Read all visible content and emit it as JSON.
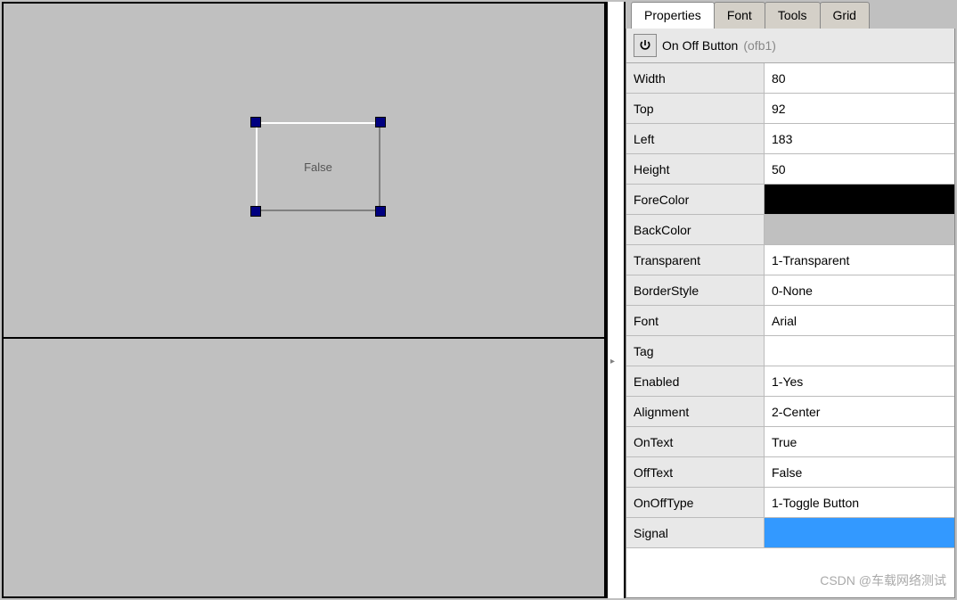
{
  "canvas": {
    "control_text": "False"
  },
  "tabs": [
    "Properties",
    "Font",
    "Tools",
    "Grid"
  ],
  "active_tab": 0,
  "header": {
    "type_label": "On Off Button",
    "control_name": "(ofb1)"
  },
  "properties": [
    {
      "label": "Width",
      "value": "80",
      "kind": "text"
    },
    {
      "label": "Top",
      "value": "92",
      "kind": "text"
    },
    {
      "label": "Left",
      "value": "183",
      "kind": "text"
    },
    {
      "label": "Height",
      "value": "50",
      "kind": "text"
    },
    {
      "label": "ForeColor",
      "value": "#000000",
      "kind": "color-black"
    },
    {
      "label": "BackColor",
      "value": "#c0c0c0",
      "kind": "color-gray"
    },
    {
      "label": "Transparent",
      "value": "1-Transparent",
      "kind": "text"
    },
    {
      "label": "BorderStyle",
      "value": "0-None",
      "kind": "text"
    },
    {
      "label": "Font",
      "value": "Arial",
      "kind": "text"
    },
    {
      "label": "Tag",
      "value": "",
      "kind": "text"
    },
    {
      "label": "Enabled",
      "value": "1-Yes",
      "kind": "text"
    },
    {
      "label": "Alignment",
      "value": "2-Center",
      "kind": "text"
    },
    {
      "label": "OnText",
      "value": "True",
      "kind": "text"
    },
    {
      "label": "OffText",
      "value": "False",
      "kind": "text"
    },
    {
      "label": "OnOffType",
      "value": "1-Toggle Button",
      "kind": "text"
    },
    {
      "label": "Signal",
      "value": "",
      "kind": "color-blue"
    }
  ],
  "watermark": "CSDN @车载网络测试"
}
